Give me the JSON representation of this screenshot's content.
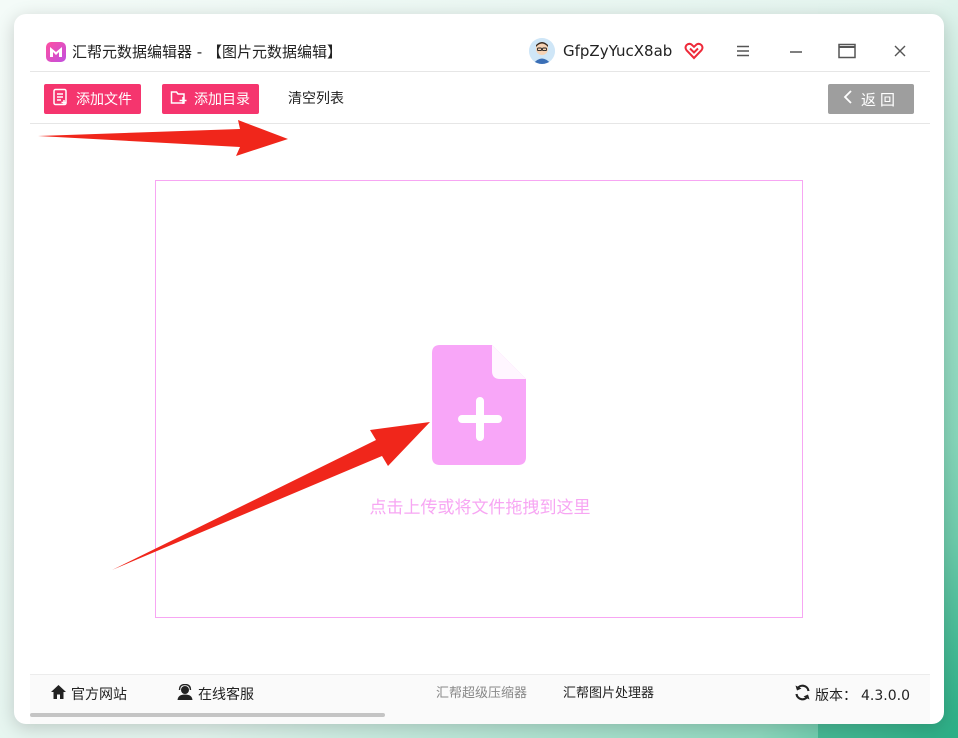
{
  "app": {
    "title": "汇帮元数据编辑器 - 【图片元数据编辑】",
    "logo_icon": "app-logo-icon"
  },
  "user": {
    "name": "GfpZyYucX8ab",
    "vip_icon": "vip-heart-icon"
  },
  "window_controls": [
    "menu-icon",
    "minimize-icon",
    "maximize-icon",
    "close-icon"
  ],
  "toolbar": {
    "add_file_label": "添加文件",
    "add_dir_label": "添加目录",
    "clear_list_label": "清空列表",
    "back_label": "返回"
  },
  "dropzone": {
    "hint": "点击上传或将文件拖拽到这里",
    "icon": "file-add-icon"
  },
  "footer": {
    "website_label": "官方网站",
    "support_label": "在线客服",
    "compressor_label": "汇帮超级压缩器",
    "image_processor_label": "汇帮图片处理器",
    "version_label": "版本：",
    "version_value": "4.3.0.0"
  },
  "colors": {
    "primary": "#f5356e",
    "dropzone_border": "#f7a6f3",
    "back_button": "#9e9e9e",
    "annotation_arrow": "#f0261b"
  }
}
